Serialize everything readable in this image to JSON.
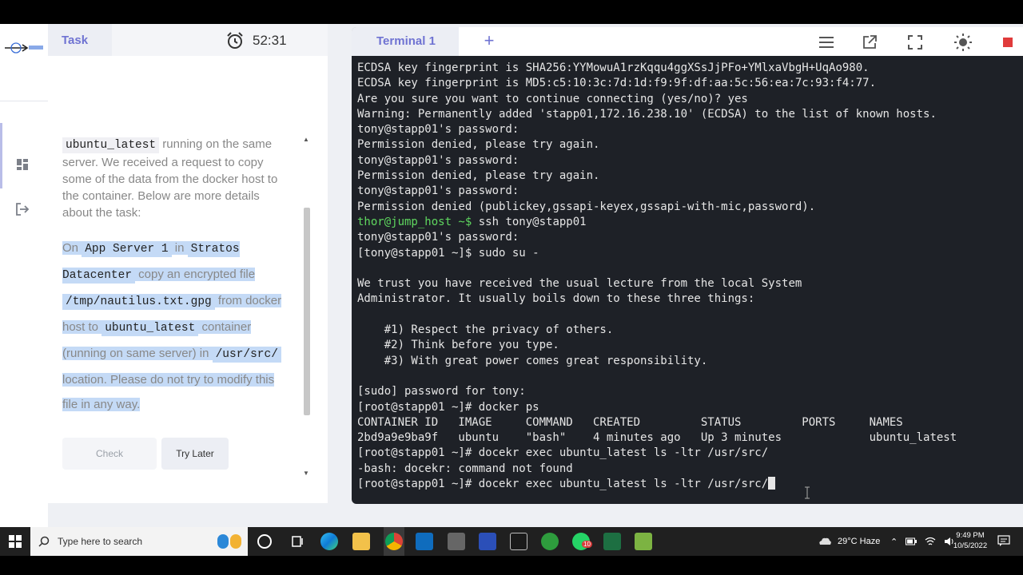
{
  "task_panel": {
    "tab_label": "Task",
    "timer": "52:31",
    "intro": [
      {
        "code": "ubuntu_latest"
      },
      {
        "text": " running on the same server. We received a request to copy some of the data from the docker host to the container. Below are more details about the task:"
      }
    ],
    "details": [
      {
        "text": "On "
      },
      {
        "code": "App Server 1"
      },
      {
        "text": " in "
      },
      {
        "code": "Stratos Datacenter"
      },
      {
        "text": " copy an encrypted file "
      },
      {
        "code": "/tmp/nautilus.txt.gpg"
      },
      {
        "text": " from docker host to "
      },
      {
        "code": "ubuntu_latest"
      },
      {
        "text": " container (running on same server) in "
      },
      {
        "code": "/usr/src/"
      },
      {
        "text": " location. Please do not try to modify this file in any way."
      }
    ],
    "check_label": "Check",
    "try_later_label": "Try Later"
  },
  "terminal": {
    "tab_label": "Terminal 1",
    "lines": [
      "ECDSA key fingerprint is SHA256:YYMowuA1rzKqqu4ggXSsJjPFo+YMlxaVbgH+UqAo980.",
      "ECDSA key fingerprint is MD5:c5:10:3c:7d:1d:f9:9f:df:aa:5c:56:ea:7c:93:f4:77.",
      "Are you sure you want to continue connecting (yes/no)? yes",
      "Warning: Permanently added 'stapp01,172.16.238.10' (ECDSA) to the list of known hosts.",
      "tony@stapp01's password:",
      "Permission denied, please try again.",
      "tony@stapp01's password:",
      "Permission denied, please try again.",
      "tony@stapp01's password:",
      "Permission denied (publickey,gssapi-keyex,gssapi-with-mic,password).",
      {
        "prompt": "thor@jump_host ~$",
        "cmd": " ssh tony@stapp01"
      },
      "tony@stapp01's password:",
      "[tony@stapp01 ~]$ sudo su -",
      "",
      "We trust you have received the usual lecture from the local System",
      "Administrator. It usually boils down to these three things:",
      "",
      "    #1) Respect the privacy of others.",
      "    #2) Think before you type.",
      "    #3) With great power comes great responsibility.",
      "",
      "[sudo] password for tony:",
      "[root@stapp01 ~]# docker ps",
      "CONTAINER ID   IMAGE     COMMAND   CREATED         STATUS         PORTS     NAMES",
      "2bd9a9e9ba9f   ubuntu    \"bash\"    4 minutes ago   Up 3 minutes             ubuntu_latest",
      "[root@stapp01 ~]# docekr exec ubuntu_latest ls -ltr /usr/src/",
      "-bash: docekr: command not found",
      "[root@stapp01 ~]# docekr exec ubuntu_latest ls -ltr /usr/src/"
    ],
    "prompt_color": "#5fd75f"
  },
  "taskbar": {
    "search_placeholder": "Type here to search",
    "weather": "29°C  Haze",
    "time": "9:49 PM",
    "date": "10/5/2022",
    "outlook_badge": "10"
  },
  "colors": {
    "accent": "#6f73d2",
    "terminal_bg": "#1e2127",
    "highlight": "#c4daf6"
  }
}
